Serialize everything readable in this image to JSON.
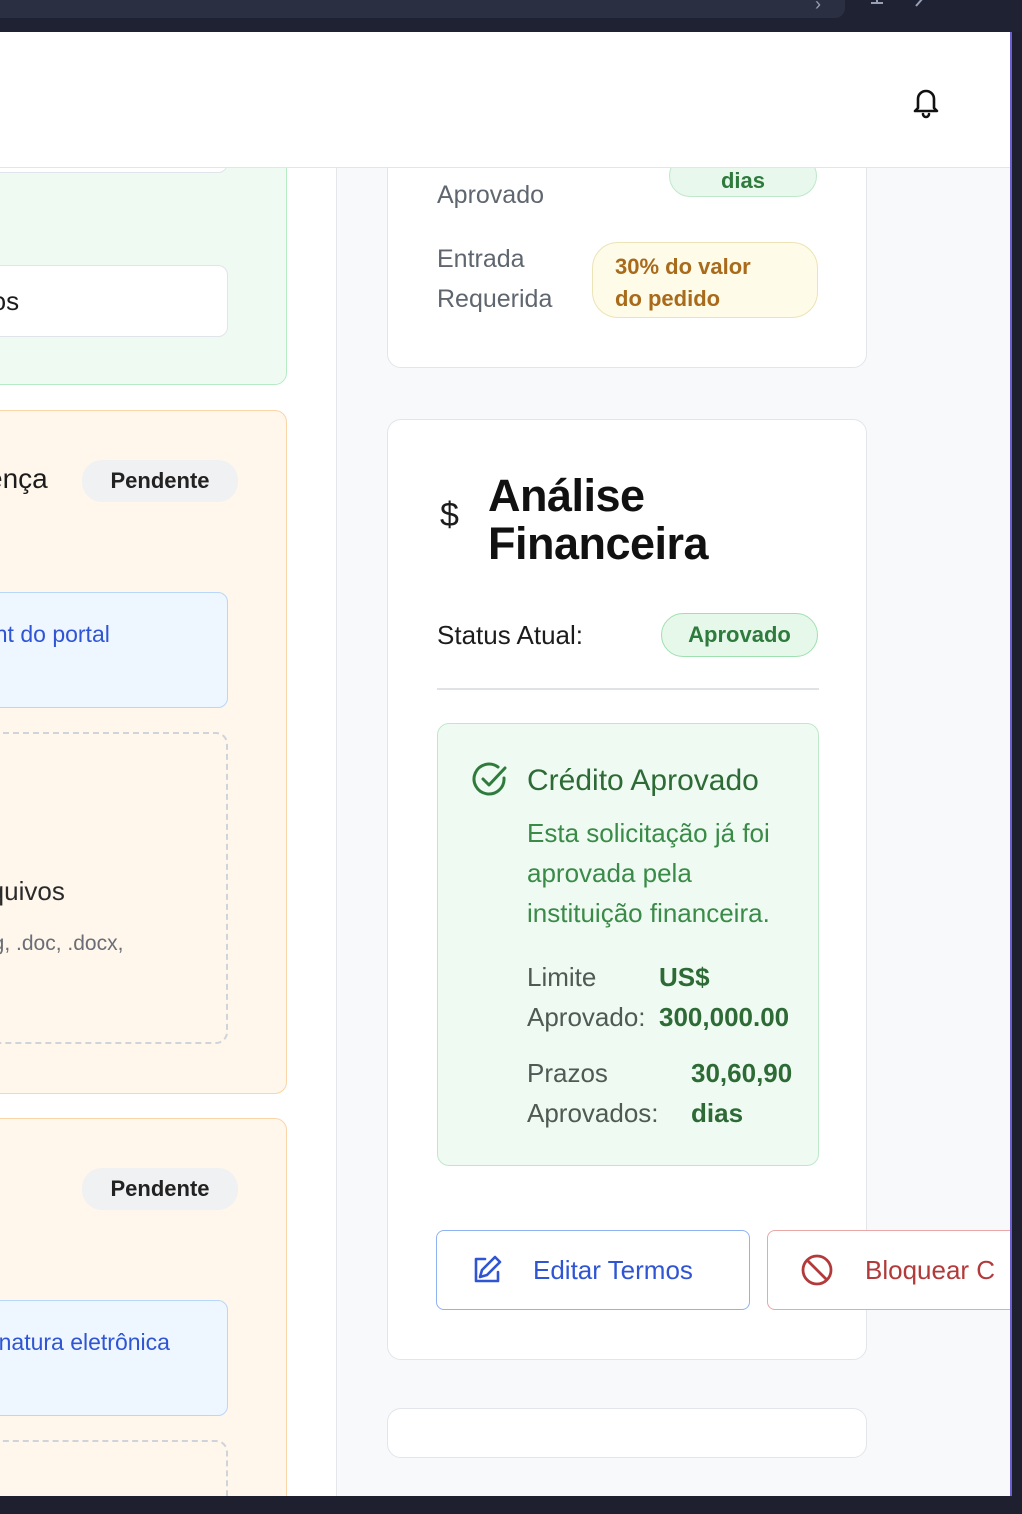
{
  "header": {
    "bell_icon": "bell-icon"
  },
  "left": {
    "documents_fragment": "ntos",
    "license_fragment": "cença",
    "license_status": "Pendente",
    "license_hint": "rint do portal",
    "upload_title_fragment": "rquivos",
    "upload_formats_fragment": "ng, .doc, .docx,",
    "signature_status": "Pendente",
    "signature_hint": "sinatura eletrônica"
  },
  "terms_card": {
    "approved_label": "Aprovado",
    "approved_value_fragment": "dias",
    "down_payment_label_1": "Entrada",
    "down_payment_label_2": "Requerida",
    "down_payment_value_1": "30% do valor",
    "down_payment_value_2": "do pedido"
  },
  "analysis": {
    "icon": "$",
    "title_1": "Análise",
    "title_2": "Financeira",
    "status_label": "Status Atual:",
    "status_value": "Aprovado",
    "credit_title": "Crédito Aprovado",
    "credit_desc_1": "Esta solicitação já foi",
    "credit_desc_2": "aprovada pela",
    "credit_desc_3": "instituição financeira.",
    "limit_label_1": "Limite",
    "limit_label_2": "Aprovado:",
    "limit_value_1": "US$",
    "limit_value_2": "300,000.00",
    "terms_label_1": "Prazos",
    "terms_label_2": "Aprovados:",
    "terms_value_1": "30,60,90",
    "terms_value_2": "dias",
    "edit_button": "Editar Termos",
    "block_button": "Bloquear C"
  },
  "colors": {
    "green_text": "#2f7a3d",
    "blue_accent": "#2f55d4",
    "red_accent": "#b23a3a",
    "amber_text": "#a86a1b"
  }
}
